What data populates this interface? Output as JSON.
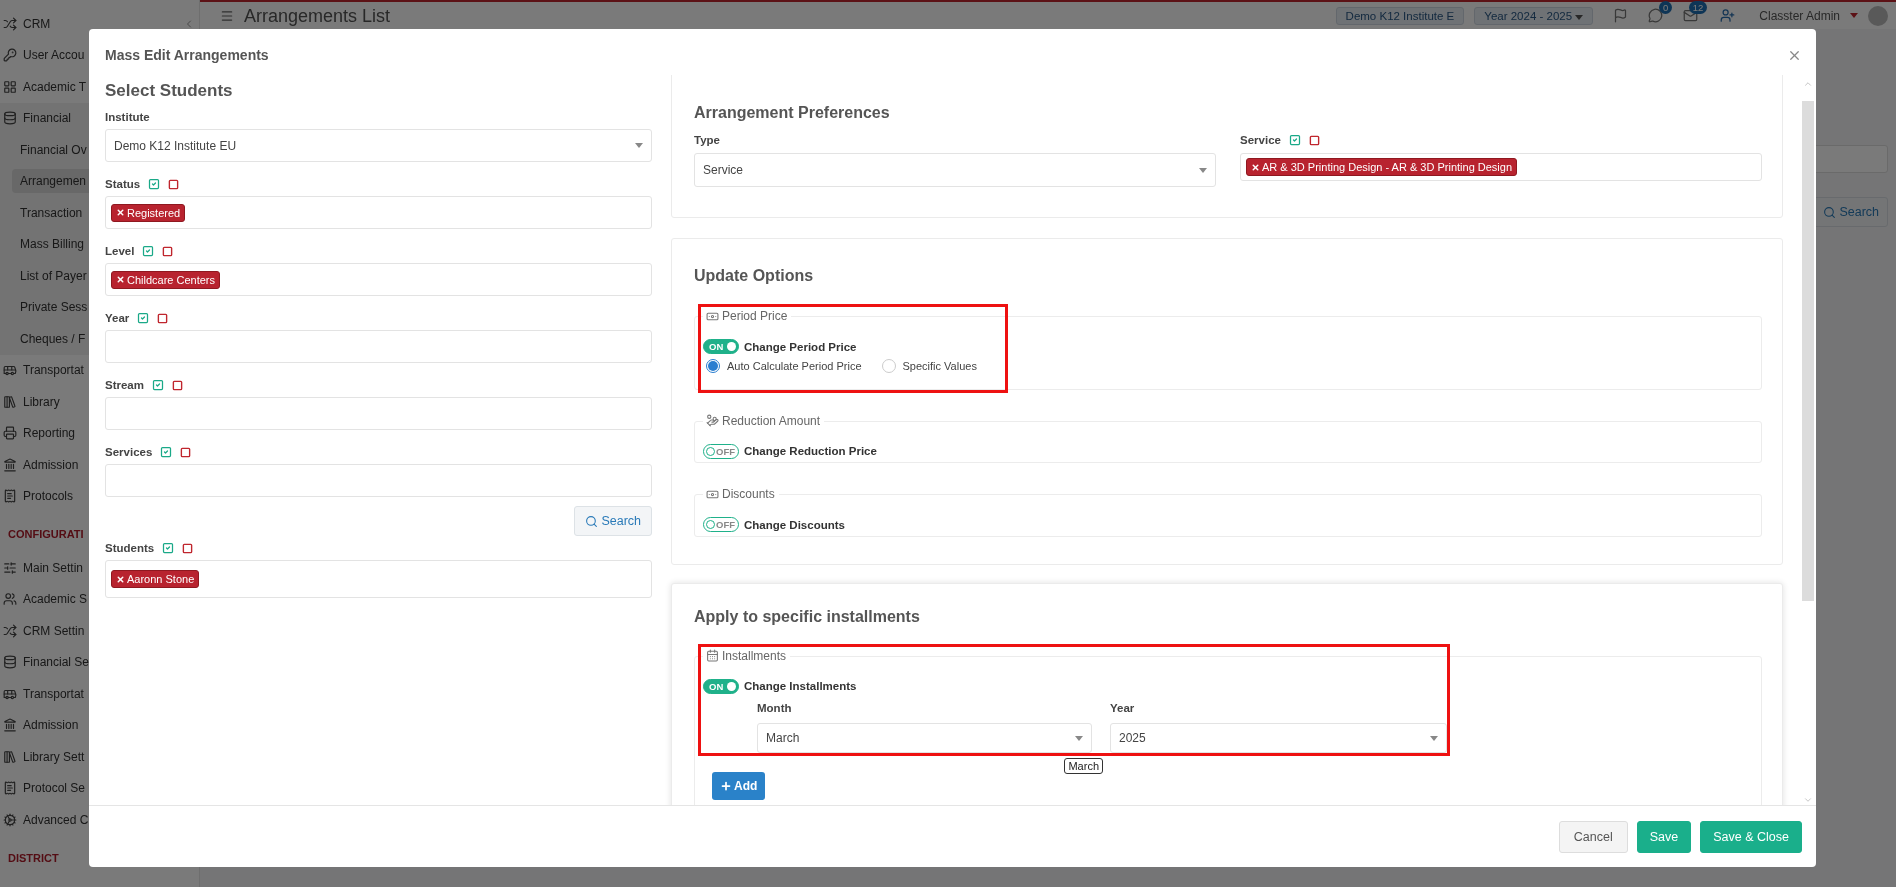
{
  "page": {
    "title": "Arrangements List",
    "institute": "Demo K12 Institute E",
    "year": "Year 2024 - 2025",
    "badges": [
      "0",
      "12"
    ],
    "user": "Classter Admin",
    "search_button": "Search"
  },
  "sidebar": {
    "items": [
      {
        "kind": "module",
        "label": "CRM"
      },
      {
        "kind": "module",
        "label": "User Accou"
      },
      {
        "kind": "module",
        "label": "Academic T"
      },
      {
        "kind": "module",
        "label": "Financial",
        "expanded": true,
        "children": [
          {
            "label": "Financial Ov",
            "selected": false
          },
          {
            "label": "Arrangemen",
            "selected": true
          },
          {
            "label": "Transaction",
            "selected": false
          },
          {
            "label": "Mass Billing",
            "selected": false
          },
          {
            "label": "List of Payer",
            "selected": false
          },
          {
            "label": "Private Sess",
            "selected": false
          },
          {
            "label": "Cheques / F",
            "selected": false
          }
        ]
      },
      {
        "kind": "module",
        "label": "Transportat"
      },
      {
        "kind": "module",
        "label": "Library"
      },
      {
        "kind": "module",
        "label": "Reporting"
      },
      {
        "kind": "module",
        "label": "Admission"
      },
      {
        "kind": "module",
        "label": "Protocols"
      },
      {
        "kind": "section",
        "label": "CONFIGURATI"
      },
      {
        "kind": "module",
        "label": "Main Settin"
      },
      {
        "kind": "module",
        "label": "Academic S"
      },
      {
        "kind": "module",
        "label": "CRM Settin"
      },
      {
        "kind": "module",
        "label": "Financial Se"
      },
      {
        "kind": "module",
        "label": "Transportat"
      },
      {
        "kind": "module",
        "label": "Admission"
      },
      {
        "kind": "module",
        "label": "Library Sett"
      },
      {
        "kind": "module",
        "label": "Protocol Se"
      },
      {
        "kind": "module",
        "label": "Advanced C"
      },
      {
        "kind": "section",
        "label": "DISTRICT"
      }
    ]
  },
  "modal": {
    "title": "Mass Edit Arrangements",
    "select_students": {
      "heading": "Select Students",
      "fields": [
        {
          "kind": "select",
          "label": "Institute",
          "value": "Demo K12 Institute EU"
        },
        {
          "kind": "tags",
          "label": "Status",
          "tags": [
            "Registered"
          ]
        },
        {
          "kind": "tags",
          "label": "Level",
          "tags": [
            "Childcare Centers"
          ]
        },
        {
          "kind": "tags",
          "label": "Year"
        },
        {
          "kind": "tags",
          "label": "Stream"
        },
        {
          "kind": "tags",
          "label": "Services"
        }
      ],
      "search_button": "Search",
      "students": {
        "label": "Students",
        "tags": [
          "Aaronn Stone"
        ]
      }
    },
    "arrangement_preferences": {
      "heading": "Arrangement Preferences",
      "type": {
        "label": "Type",
        "value": "Service"
      },
      "service": {
        "label": "Service",
        "tags": [
          "AR & 3D Printing Design - AR & 3D Printing Design"
        ]
      }
    },
    "update_options": {
      "heading": "Update Options",
      "options": [
        {
          "legend": "Period Price",
          "label": "Change Period Price",
          "on": true,
          "switch_text": "ON",
          "highlighted": true,
          "radios": [
            {
              "label": "Auto Calculate Period Price",
              "selected": true
            },
            {
              "label": "Specific Values",
              "selected": false
            }
          ]
        },
        {
          "legend": "Reduction Amount",
          "label": "Change Reduction Price",
          "on": false,
          "switch_text": "OFF",
          "highlighted": false
        },
        {
          "legend": "Discounts",
          "label": "Change Discounts",
          "on": false,
          "switch_text": "OFF",
          "highlighted": false
        }
      ]
    },
    "installments": {
      "heading": "Apply to specific installments",
      "legend": "Installments",
      "label": "Change Installments",
      "on": true,
      "switch_text": "ON",
      "highlighted": true,
      "month": {
        "label": "Month",
        "value": "March",
        "tooltip": "March"
      },
      "year": {
        "label": "Year",
        "value": "2025"
      },
      "add_button": "Add"
    },
    "footer": {
      "buttons": [
        {
          "kind": "secondary",
          "label": "Cancel"
        },
        {
          "kind": "primary",
          "label": "Save"
        },
        {
          "kind": "primary",
          "label": "Save & Close"
        }
      ]
    }
  }
}
